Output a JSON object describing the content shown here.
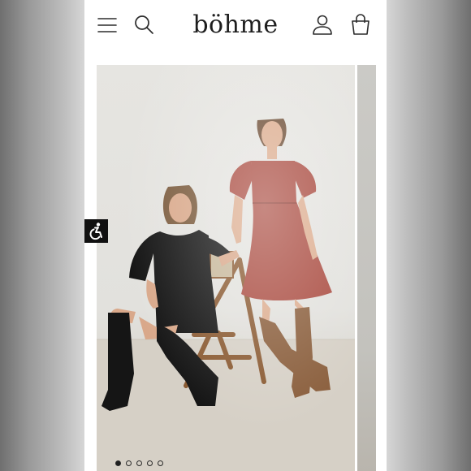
{
  "header": {
    "logo": "böhme",
    "menu_icon": "hamburger-menu-icon",
    "search_icon": "search-icon",
    "account_icon": "account-icon",
    "cart_icon": "shopping-bag-icon"
  },
  "gallery": {
    "image_count": 5,
    "active_index": 0,
    "next_image_peek": true
  },
  "accessibility_button": {
    "icon": "accessibility-icon"
  },
  "colors": {
    "page_bg": "#ffffff",
    "icon": "#2b2b2b",
    "logo": "#1e1e1e",
    "dress_rust": "#a94a3f",
    "dress_black": "#141414",
    "boots_brown": "#8a5e3c",
    "boots_black": "#151515"
  }
}
